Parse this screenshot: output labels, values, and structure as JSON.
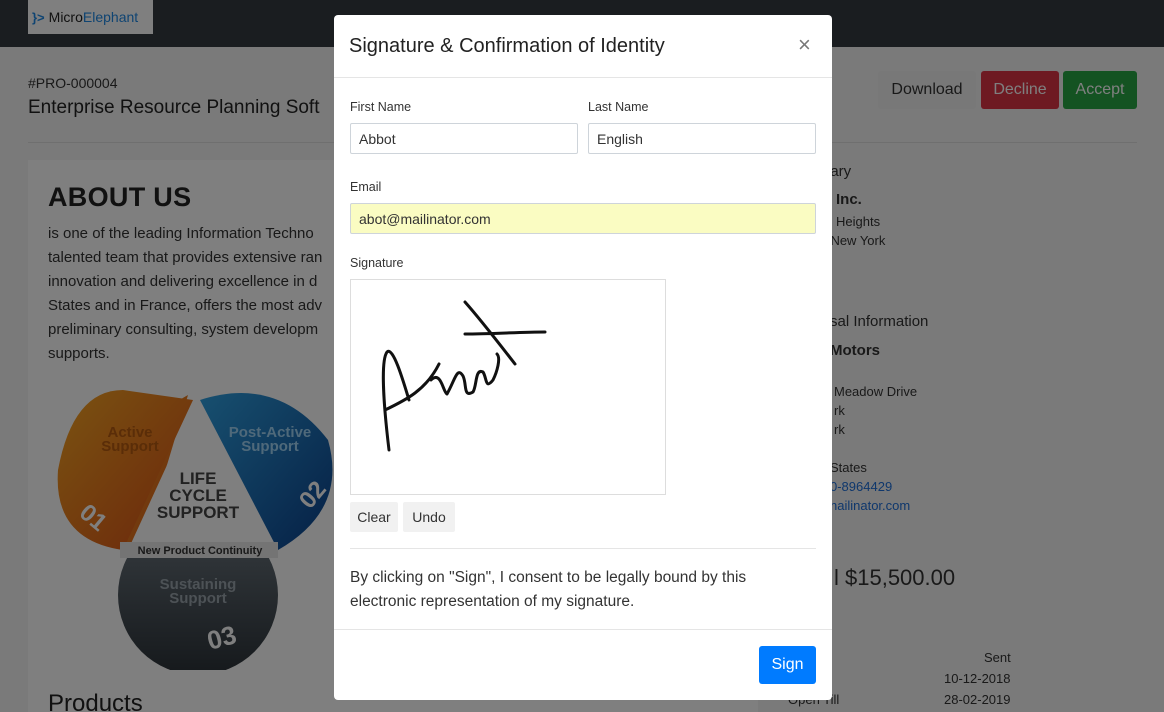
{
  "brand": {
    "mark": "}>",
    "name_part1": "Micro",
    "name_part2": "Elephant"
  },
  "header": {
    "proposal_number": "#PRO-000004",
    "proposal_title": "Enterprise Resource Planning Soft",
    "download_label": "Download",
    "decline_label": "Decline",
    "accept_label": "Accept"
  },
  "about": {
    "title": "ABOUT US",
    "lines": [
      "is one of the leading Information Techno",
      "talented team that provides extensive ran",
      "innovation and delivering excellence in d",
      "States and in France, offers the most adv",
      "preliminary consulting, system developm",
      "supports."
    ],
    "lifecycle": {
      "active": [
        "Active",
        "Support"
      ],
      "active_num": "01",
      "post_active": [
        "Post-Active",
        "Support"
      ],
      "post_active_num": "02",
      "center": [
        "LIFE",
        "CYCLE",
        "SUPPORT"
      ],
      "continuity": "New Product Continuity",
      "sustaining": [
        "Sustaining",
        "Support"
      ],
      "sustaining_num": "03"
    },
    "products_title": "Products"
  },
  "right": {
    "to_label": "nary",
    "company": "Inc.",
    "addr1": "Heights",
    "addr2": "rk New York",
    "proposal_info_title": "sal Information",
    "client": "Motors",
    "client_addr1": "Meadow Drive",
    "client_addr2": "rk",
    "client_addr3": "rk",
    "country": "States",
    "phone": "0-8964429",
    "email": "nailinator.com",
    "total": "l $15,500.00",
    "status_value": "Sent",
    "date_label": "",
    "date_value": "10-12-2018",
    "open_till_label": "Open Till",
    "open_till_value": "28-02-2019"
  },
  "modal": {
    "title": "Signature & Confirmation of Identity",
    "close": "×",
    "first_name_label": "First Name",
    "first_name_value": "Abbot",
    "last_name_label": "Last Name",
    "last_name_value": "English",
    "email_label": "Email",
    "email_value": "abot@mailinator.com",
    "signature_label": "Signature",
    "clear_label": "Clear",
    "undo_label": "Undo",
    "consent_text": "By clicking on \"Sign\", I consent to be legally bound by this electronic representation of my signature.",
    "sign_label": "Sign"
  },
  "colors": {
    "navbar": "#343a40",
    "brand_accent": "#1e88e5",
    "decline": "#dc3545",
    "accept": "#28a745",
    "primary": "#007bff",
    "email_autofill": "#fafcc2"
  }
}
